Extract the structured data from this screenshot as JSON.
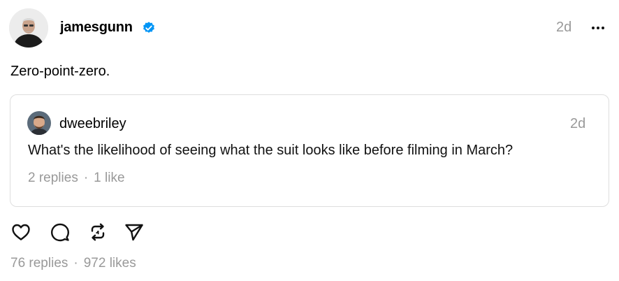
{
  "post": {
    "username": "jamesgunn",
    "verified": true,
    "timestamp": "2d",
    "text": "Zero-point-zero.",
    "icons": {
      "more": "more-horizontal-icon",
      "verified": "verified-badge-icon"
    }
  },
  "quoted_post": {
    "username": "dweebriley",
    "timestamp": "2d",
    "text": "What's the likelihood of seeing what the suit looks like before filming in March?",
    "replies": "2 replies",
    "separator": "·",
    "likes": "1 like"
  },
  "actions": [
    {
      "name": "like",
      "icon": "heart-icon"
    },
    {
      "name": "reply",
      "icon": "comment-icon"
    },
    {
      "name": "repost",
      "icon": "repost-icon"
    },
    {
      "name": "share",
      "icon": "send-icon"
    }
  ],
  "stats": {
    "replies": "76 replies",
    "separator": "·",
    "likes": "972 likes"
  },
  "colors": {
    "verified": "#0095f6",
    "muted_text": "#999999",
    "card_border": "#dedede"
  }
}
